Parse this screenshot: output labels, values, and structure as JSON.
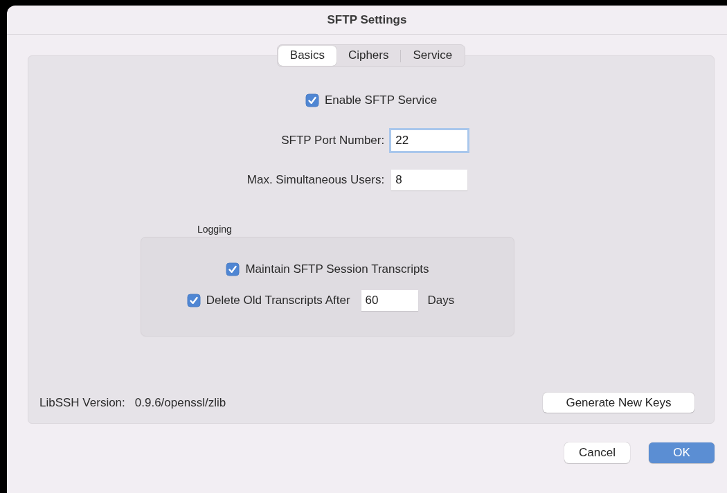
{
  "window": {
    "title": "SFTP Settings"
  },
  "tabs": [
    {
      "label": "Basics",
      "selected": true
    },
    {
      "label": "Ciphers",
      "selected": false
    },
    {
      "label": "Service",
      "selected": false
    }
  ],
  "enable_service": {
    "label": "Enable SFTP Service",
    "checked": true
  },
  "fields": [
    {
      "label": "SFTP Port Number:",
      "value": "22",
      "focused": true
    },
    {
      "label": "Max. Simultaneous Users:",
      "value": "8",
      "focused": false
    }
  ],
  "logging": {
    "title": "Logging",
    "maintain": {
      "label": "Maintain SFTP Session Transcripts",
      "checked": true
    },
    "delete": {
      "label": "Delete Old Transcripts After",
      "checked": true,
      "value": "60",
      "unit": "Days"
    }
  },
  "version": {
    "label": "LibSSH Version:",
    "value": "0.9.6/openssl/zlib"
  },
  "generate_button": "Generate New Keys",
  "buttons": [
    {
      "label": "Cancel",
      "kind": "normal"
    },
    {
      "label": "OK",
      "kind": "default"
    }
  ]
}
